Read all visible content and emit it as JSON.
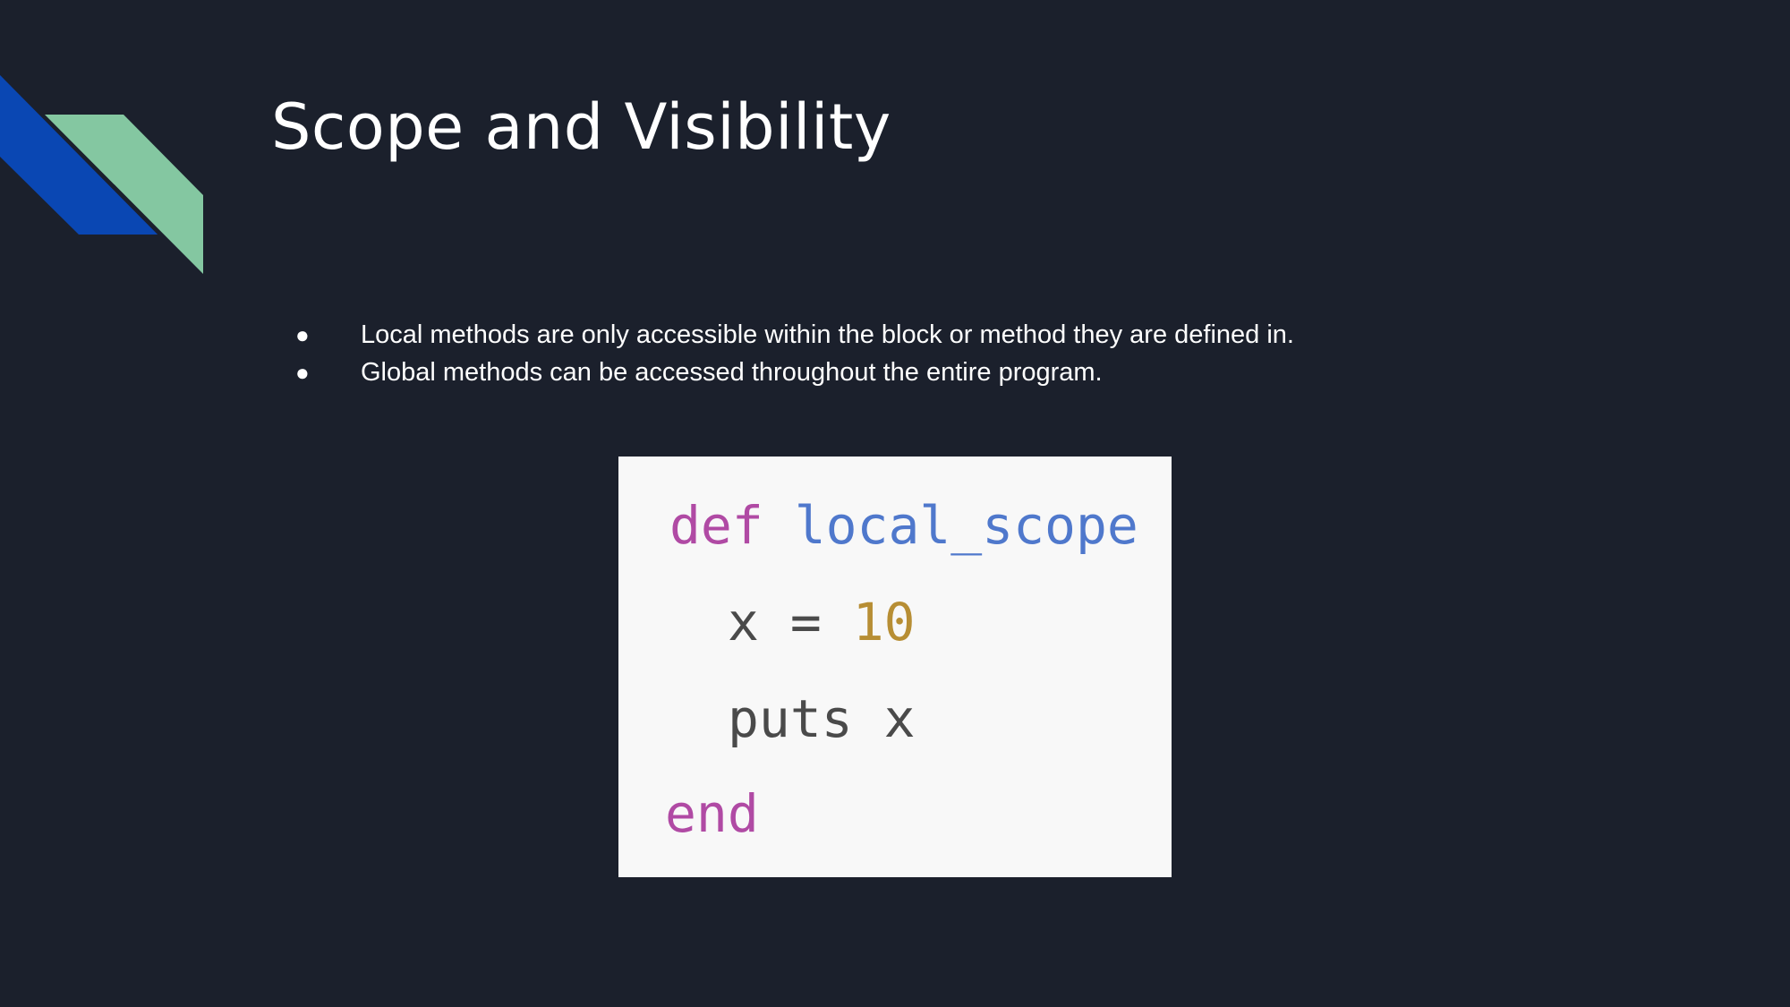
{
  "slide": {
    "title": "Scope and Visibility",
    "bullets": [
      "Local methods are only accessible within the block or method they are defined in.",
      "Global methods can be accessed throughout the entire program."
    ],
    "bullet_glyph": "●"
  },
  "code": {
    "line1": {
      "keyword": "def",
      "name": "local_scope"
    },
    "line2": {
      "variable": "x",
      "operator": "=",
      "number": "10"
    },
    "line3": {
      "method": "puts",
      "argument": "x"
    },
    "line4": {
      "keyword": "end"
    }
  },
  "colors": {
    "background": "#1b202c",
    "accent_blue": "#0a47b3",
    "accent_green": "#84c7a1",
    "code_background": "#f8f8f8",
    "keyword": "#b04aa4",
    "function_name": "#4f78cc",
    "number": "#b78e34"
  }
}
